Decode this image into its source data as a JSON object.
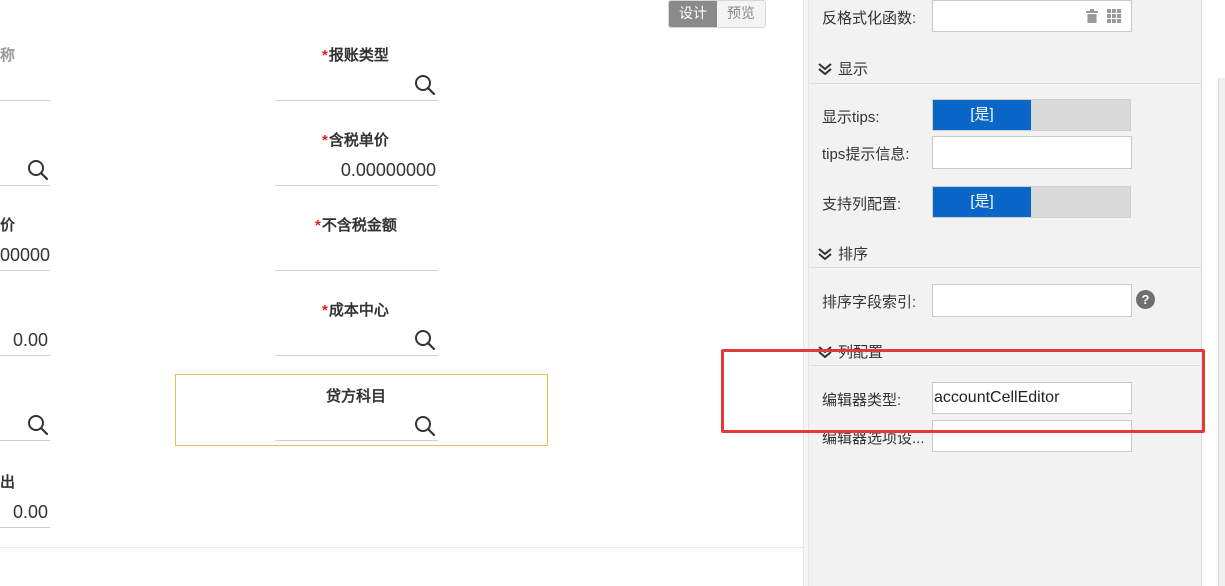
{
  "mode_toggle": {
    "design": "设计",
    "preview": "预览"
  },
  "form": {
    "fields": [
      {
        "label": "称",
        "required": false
      },
      {
        "label": "报账类型",
        "required": true
      },
      {
        "label": "含税单价",
        "required": true,
        "value": "0.00000000"
      },
      {
        "label": "价",
        "required": false,
        "value": "00000"
      },
      {
        "label": "不含税金额",
        "required": true
      },
      {
        "label": "成本中心",
        "required": true
      },
      {
        "left_value": "0.00"
      },
      {
        "label": "贷方科目",
        "required": false
      },
      {
        "label": "出",
        "required": false,
        "value": "0.00"
      }
    ],
    "required_mark": "*"
  },
  "panel": {
    "unformat_func_label": "反格式化函数:",
    "section_display": "显示",
    "show_tips_label": "显示tips:",
    "show_tips_value": "[是]",
    "tips_info_label": "tips提示信息:",
    "tips_info_value": "",
    "support_col_config_label": "支持列配置:",
    "support_col_config_value": "[是]",
    "section_sort": "排序",
    "sort_field_label": "排序字段索引:",
    "sort_field_value": "",
    "help_mark": "?",
    "section_col_config": "列配置",
    "editor_type_label": "编辑器类型:",
    "editor_type_value": "accountCellEditor",
    "editor_options_label": "编辑器选项设...",
    "editor_options_value": ""
  },
  "colors": {
    "accent_blue": "#0b67c7",
    "required_red": "#e02020",
    "highlight_red": "#e23a3a",
    "selected_border": "#e7c04d"
  }
}
